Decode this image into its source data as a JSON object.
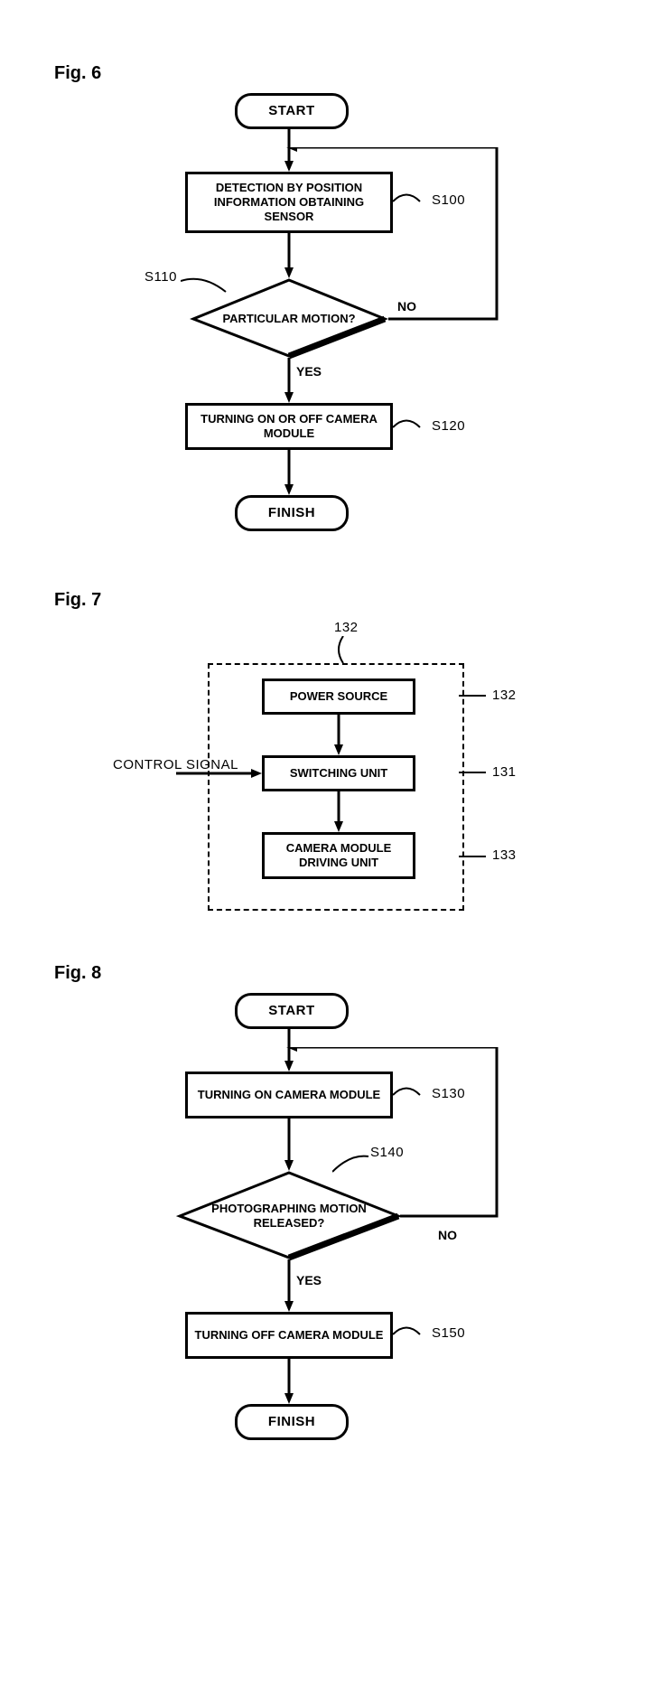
{
  "fig6": {
    "label": "Fig. 6",
    "start": "START",
    "s100_text": "DETECTION BY POSITION INFORMATION OBTAINING SENSOR",
    "s100_ref": "S100",
    "s110_ref": "S110",
    "decision_text": "PARTICULAR MOTION?",
    "decision_yes": "YES",
    "decision_no": "NO",
    "s120_text": "TURNING ON OR OFF CAMERA MODULE",
    "s120_ref": "S120",
    "finish": "FINISH"
  },
  "fig7": {
    "label": "Fig. 7",
    "group_ref": "132",
    "power_source": "POWER SOURCE",
    "power_ref": "132",
    "switching": "SWITCHING UNIT",
    "switching_ref": "131",
    "driving": "CAMERA MODULE DRIVING UNIT",
    "driving_ref": "133",
    "control_signal": "CONTROL SIGNAL"
  },
  "fig8": {
    "label": "Fig. 8",
    "start": "START",
    "s130_text": "TURNING ON CAMERA MODULE",
    "s130_ref": "S130",
    "s140_ref": "S140",
    "decision_text": "PHOTOGRAPHING MOTION RELEASED?",
    "decision_yes": "YES",
    "decision_no": "NO",
    "s150_text": "TURNING OFF CAMERA MODULE",
    "s150_ref": "S150",
    "finish": "FINISH"
  }
}
